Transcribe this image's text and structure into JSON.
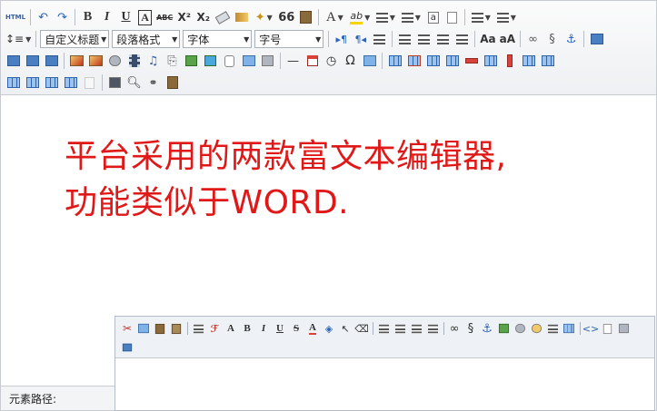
{
  "editor1": {
    "toolbar": {
      "html_label": "HTML",
      "bold_label": "B",
      "italic_label": "I",
      "underline_label": "U",
      "border_label": "A",
      "strike_label": "ABC",
      "superscript_label": "X²",
      "subscript_label": "X₂",
      "quote_label": "66",
      "fontcolor_label": "A",
      "highlight_label": "ab",
      "custom_heading_select": "自定义标题",
      "paragraph_format_select": "段落格式",
      "font_family_select": "字体",
      "font_size_select": "字号",
      "omega_label": "Ω"
    },
    "content_text_line1": "平台采用的两款富文本编辑器,",
    "content_text_line2": "功能类似于WORD.",
    "status_path_label": "元素路径:"
  },
  "editor2": {
    "toolbar": {
      "bold_label": "B",
      "italic_label": "I",
      "underline_label": "U",
      "strike_label": "S",
      "fontcolor_label": "A",
      "fontfamily_label": "A"
    }
  },
  "colors": {
    "headline": "#e01818",
    "toolbar_bg": "#eef0f3",
    "border": "#c8ccd2"
  }
}
